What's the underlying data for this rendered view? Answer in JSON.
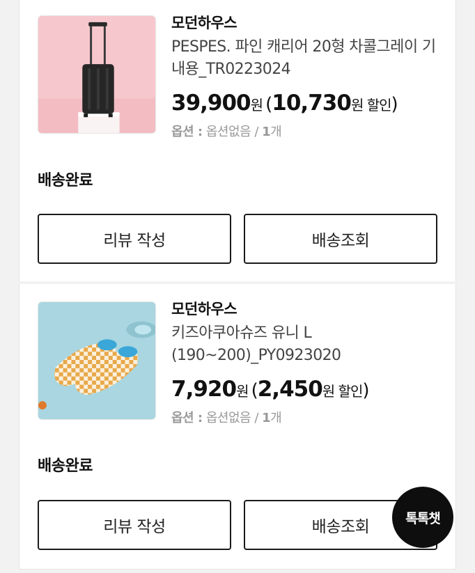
{
  "orders": [
    {
      "seller": "모던하우스",
      "product_name": "PESPES. 파인 캐리어 20형 차콜그레이 기내용_TR0223024",
      "price": "39,900",
      "price_unit": "원",
      "discount": "10,730",
      "discount_unit": "원 할인",
      "option_label": "옵션 :",
      "option_value": "옵션없음",
      "quantity": "1",
      "quantity_unit": "개",
      "status": "배송완료",
      "review_button": "리뷰 작성",
      "track_button": "배송조회",
      "image_icon": "suitcase-image"
    },
    {
      "seller": "모던하우스",
      "product_name": "키즈아쿠아슈즈 유니 L (190~200)_PY0923020",
      "price": "7,920",
      "price_unit": "원",
      "discount": "2,450",
      "discount_unit": "원 할인",
      "option_label": "옵션 :",
      "option_value": "옵션없음",
      "quantity": "1",
      "quantity_unit": "개",
      "status": "배송완료",
      "review_button": "리뷰 작성",
      "track_button": "배송조회",
      "image_icon": "aqua-shoes-image"
    }
  ],
  "chat_button": "톡톡챗"
}
